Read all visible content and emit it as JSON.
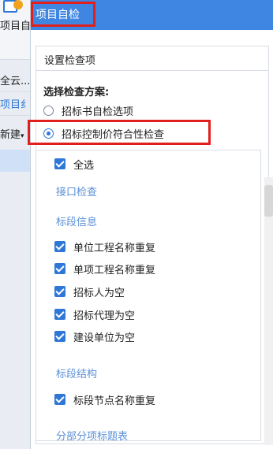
{
  "background": {
    "toolbar_label": "项目自",
    "row1": "全云...",
    "row2": "项目纟",
    "row3": "新建",
    "row3_arrow": "▾"
  },
  "dialog": {
    "title": "项目自检",
    "section_header": "设置检查项",
    "scheme_label": "选择检查方案:",
    "schemes": [
      {
        "label": "招标书自检选项",
        "selected": false
      },
      {
        "label": "招标控制价符合性检查",
        "selected": true
      }
    ],
    "select_all": "全选",
    "categories": [
      {
        "label": "接口检查",
        "items": []
      },
      {
        "label": "标段信息",
        "items": [
          "单位工程名称重复",
          "单项工程名称重复",
          "招标人为空",
          "招标代理为空",
          "建设单位为空"
        ]
      },
      {
        "label": "标段结构",
        "items": [
          "标段节点名称重复"
        ]
      },
      {
        "label": "分部分项标题表",
        "items": []
      }
    ]
  },
  "colors": {
    "accent": "#3e86e2",
    "highlight_box": "#e0201c",
    "category_text": "#5a8fd6"
  }
}
